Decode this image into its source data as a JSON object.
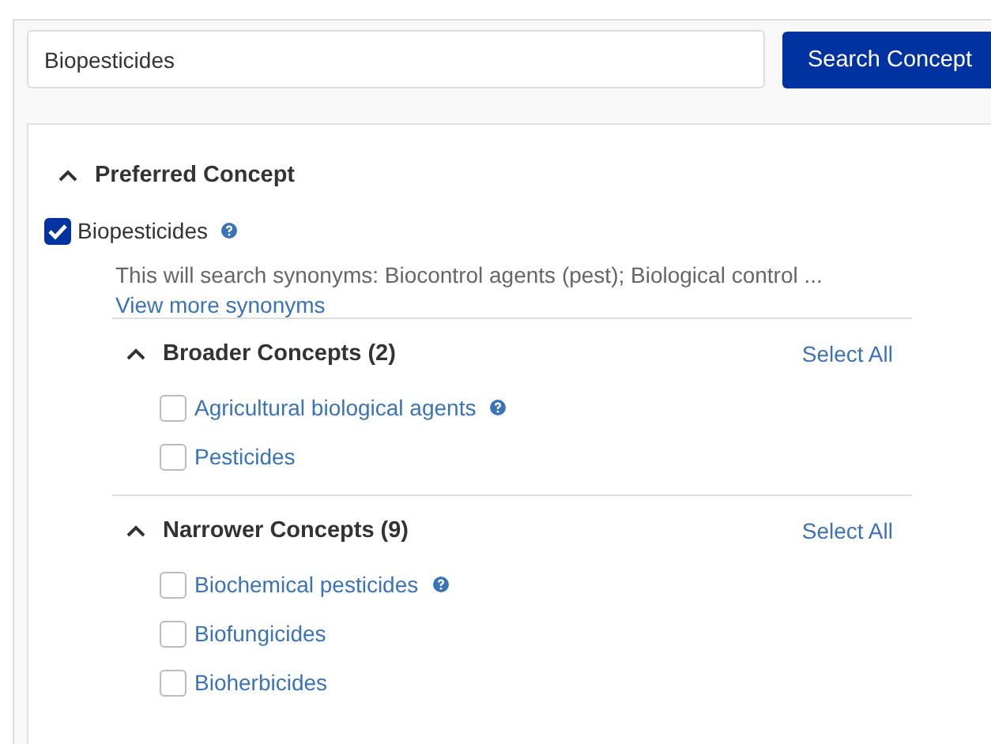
{
  "search": {
    "value": "Biopesticides",
    "button": "Search Concept"
  },
  "preferred": {
    "title": "Preferred Concept",
    "expanded": true,
    "concept": {
      "label": "Biopesticides",
      "checked": true,
      "help": true
    },
    "synonyms": "This will search synonyms: Biocontrol agents (pest); Biological control ...",
    "more_link": "View more synonyms"
  },
  "groups": [
    {
      "title": "Broader Concepts (2)",
      "expanded": true,
      "select_all": "Select All",
      "items": [
        {
          "label": "Agricultural biological agents",
          "checked": false,
          "help": true
        },
        {
          "label": "Pesticides",
          "checked": false,
          "help": false
        }
      ]
    },
    {
      "title": "Narrower Concepts (9)",
      "expanded": true,
      "select_all": "Select All",
      "items": [
        {
          "label": "Biochemical pesticides",
          "checked": false,
          "help": true
        },
        {
          "label": "Biofungicides",
          "checked": false,
          "help": false
        },
        {
          "label": "Bioherbicides",
          "checked": false,
          "help": false
        }
      ]
    }
  ]
}
